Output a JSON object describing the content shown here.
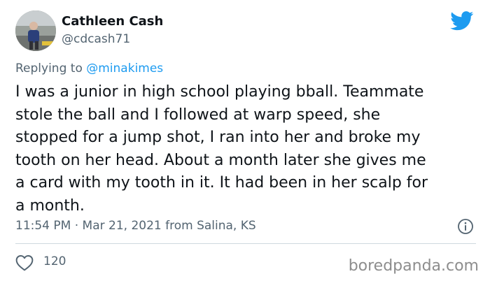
{
  "author": {
    "name": "Cathleen Cash",
    "handle": "@cdcash71"
  },
  "reply": {
    "prefix": "Replying to ",
    "mention": "@minakimes"
  },
  "tweet": {
    "lines": [
      "I was a junior in high school playing bball. Teammate",
      "stole the ball and I followed at warp speed, she",
      "stopped for a jump shot, I ran into her and broke my",
      "tooth on her head. About a month later she gives me",
      "a card with my tooth in it. It had been in her scalp for",
      "a month."
    ]
  },
  "meta": {
    "timestamp": "11:54 PM · Mar 21, 2021 from Salina, KS"
  },
  "stats": {
    "likes": "120"
  },
  "watermark": "boredpanda.com",
  "colors": {
    "twitter_blue": "#1d9bf0",
    "muted_text": "#536471",
    "divider": "#cfd9de"
  },
  "icons": [
    "twitter-bird-icon",
    "info-icon",
    "heart-icon"
  ]
}
